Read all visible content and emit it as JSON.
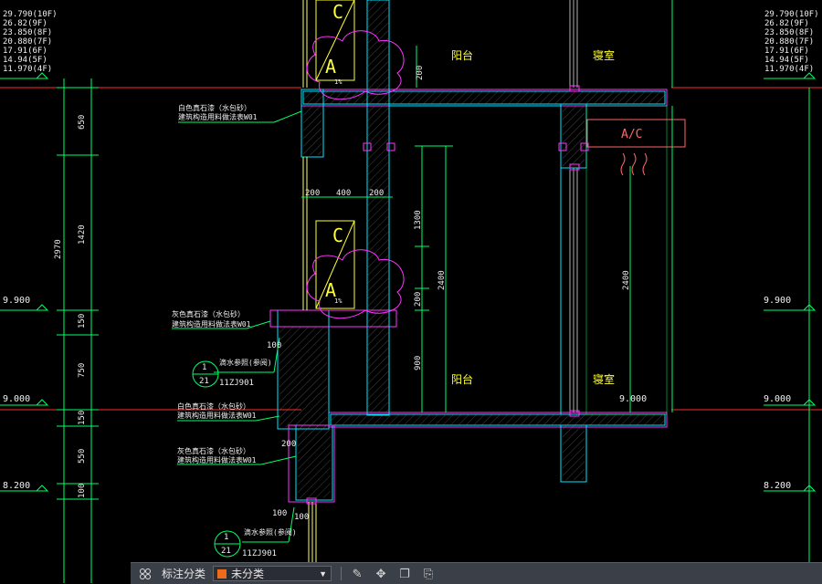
{
  "colors": {
    "background": "#000000",
    "level_line": "#ff2a2a",
    "dimension": "#00ff66",
    "wall_outline": "#00e5ff",
    "slab_outline": "#ff33ff",
    "label_yellow": "#ffff33",
    "window": "#ffff66",
    "ac_box": "#ff6666",
    "toolbar_bg": "#3b3f47"
  },
  "floor_levels_left": [
    "29.790(10F)",
    "26.82(9F)",
    "23.850(8F)",
    "20.880(7F)",
    "17.91(6F)",
    "14.94(5F)",
    "11.970(4F)"
  ],
  "floor_levels_right": [
    "29.790(10F)",
    "26.82(9F)",
    "23.850(8F)",
    "20.880(7F)",
    "17.91(6F)",
    "14.94(5F)",
    "11.970(4F)"
  ],
  "level_marks": {
    "l9900": "9.900",
    "l9000": "9.000",
    "l8200": "8.200",
    "r9900": "9.900",
    "r9000": "9.000",
    "r8200": "8.200",
    "inner9000": "9.000"
  },
  "vertical_dims": {
    "d650": "650",
    "d1420": "1420",
    "d2970": "2970",
    "d150a": "150",
    "d750": "750",
    "d150b": "150",
    "d550": "550",
    "d100": "100",
    "d1300": "1300",
    "d200": "200",
    "d900": "900",
    "d2400a": "2400",
    "d2400b": "2400",
    "d200top": "200"
  },
  "horizontal_dims": {
    "h200a": "200",
    "h400": "400",
    "h200b": "200",
    "h100a": "100",
    "h200c": "200",
    "h100b": "100",
    "h100c": "100"
  },
  "annotations": {
    "a1_line1": "白色真石漆（水包砂）",
    "a1_line2": "建筑构造用料做法表W01",
    "a2_line1": "灰色真石漆（水包砂）",
    "a2_line2": "建筑构造用料做法表W01",
    "a3_line1": "白色真石漆（水包砂）",
    "a3_line2": "建筑构造用料做法表W01",
    "a4_line1": "灰色真石漆（水包砂）",
    "a4_line2": "建筑构造用料做法表W01"
  },
  "detail_refs": [
    {
      "top": "1",
      "bottom": "21",
      "label": "滴水参照(参阅)",
      "code": "11ZJ901"
    },
    {
      "top": "1",
      "bottom": "21",
      "label": "滴水参照(参阅)",
      "code": "11ZJ901"
    }
  ],
  "rooms": {
    "balcony_top": "阳台",
    "bedroom_top": "寝室",
    "balcony_mid": "阳台",
    "bedroom_mid": "寝室"
  },
  "ac": {
    "box_label": "A/C",
    "unit_letter_top_a": "A",
    "unit_letter_top_c": "C",
    "unit_letter_mid_a": "A",
    "unit_letter_mid_c": "C",
    "slope_a": "1%",
    "slope_b": "1%"
  },
  "toolbar": {
    "icon": "grid-cluster-icon",
    "label": "标注分类",
    "selected_category": "未分类",
    "swatch_color": "#ef6a1a",
    "buttons": [
      "edit-icon",
      "move-icon",
      "copy-icon",
      "paste-icon"
    ]
  }
}
